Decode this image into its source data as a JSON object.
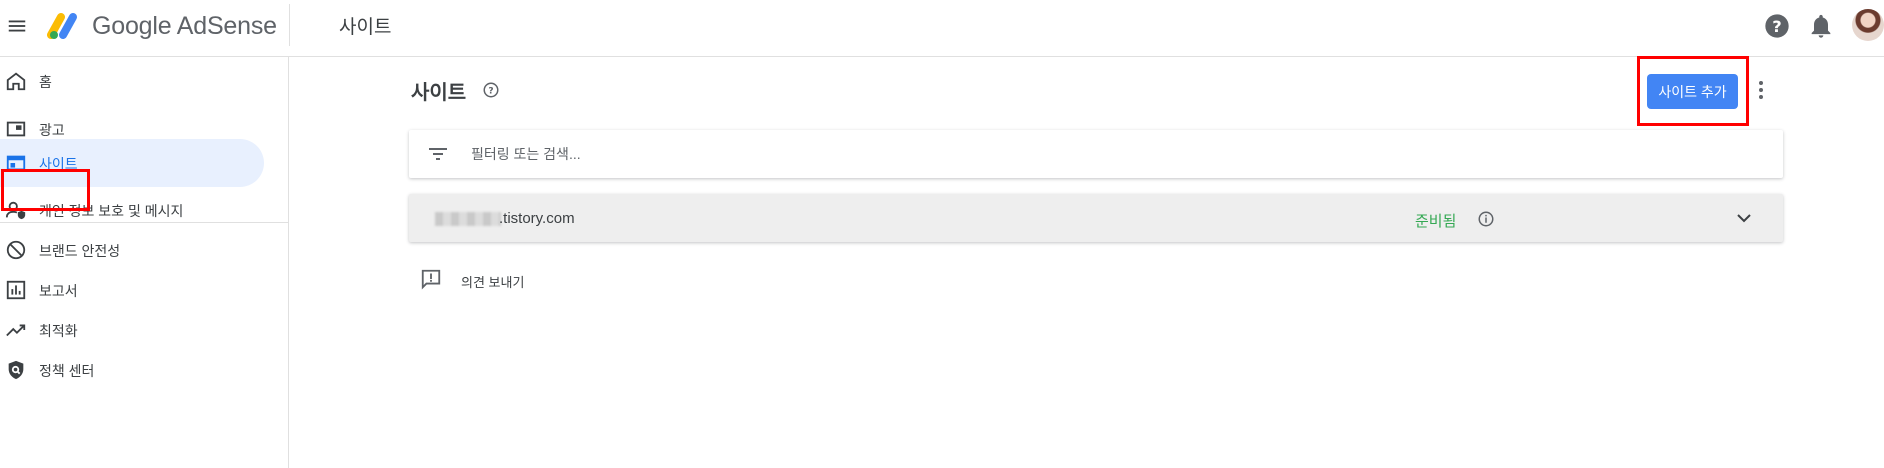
{
  "app": {
    "brand": "Google AdSense",
    "page_title": "사이트",
    "brand_colors": [
      "#fbbc04",
      "#4285f4",
      "#34a853"
    ]
  },
  "topbar": {
    "icons": [
      "menu-icon",
      "help-icon",
      "notifications-icon",
      "avatar"
    ]
  },
  "sidebar": {
    "items": [
      {
        "label": "홈",
        "icon": "home-icon"
      },
      {
        "label": "광고",
        "icon": "ads-icon"
      },
      {
        "label": "사이트",
        "icon": "sites-icon",
        "active": true
      },
      {
        "label": "개인 정보 보호 및 메시지",
        "icon": "privacy-messaging-icon"
      },
      {
        "label": "브랜드 안전성",
        "icon": "brand-safety-icon"
      },
      {
        "label": "보고서",
        "icon": "reports-icon"
      },
      {
        "label": "최적화",
        "icon": "optimization-icon"
      },
      {
        "label": "정책 센터",
        "icon": "policy-center-icon"
      }
    ]
  },
  "main": {
    "title": "사이트",
    "add_site_button": "사이트 추가",
    "filter_placeholder": "필터링 또는 검색...",
    "sites": [
      {
        "name": ".tistory.com",
        "status": "준비됨",
        "status_color": "#34a853"
      }
    ],
    "feedback_label": "의견 보내기"
  },
  "highlight_color": "#ff0000",
  "accent_color": "#4285f4"
}
